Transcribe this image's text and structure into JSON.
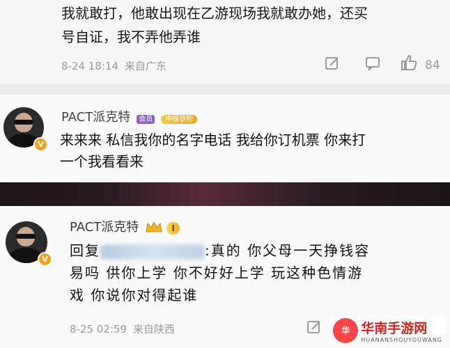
{
  "comment1": {
    "text_line1": "我就敢打，他敢出现在乙游现场我就敢办她，还买",
    "text_line2": "号自证，我不弄他弄谁",
    "time": "8-24 18:14",
    "location": "来自广东",
    "like_count": "84"
  },
  "comment2": {
    "username": "PACT派克特",
    "tag_member": "会员",
    "tag_level": "中级铁粉",
    "text_line1": "来来来 私信我你的名字电话 我给你订机票 你来打",
    "text_line2": "一个我看看来"
  },
  "comment3": {
    "username": "PACT派克特",
    "fan_level": "I",
    "reply_prefix": "回复",
    "reply_suffix": ":真的 你父母一天挣钱容",
    "text_line2": "易吗 供你上学 你不好好上学 玩这种色情游",
    "text_line3": "戏 你说你对得起谁",
    "time": "8-25 02:59",
    "location": "来自陕西"
  },
  "watermark": {
    "title": "华南手游网",
    "subtitle": "HUANANSHOUYOUWANG",
    "logo_text": "华"
  },
  "icons": {
    "share": "share-icon",
    "comment": "comment-icon",
    "like": "thumbs-up-icon",
    "verified": "verified-v-icon",
    "crown": "crown-icon"
  },
  "colors": {
    "meta_gray": "#9a9a9a",
    "badge_orange": "#f4a11a",
    "badge_gold": "#f0b626",
    "watermark_red": "#d02020"
  }
}
